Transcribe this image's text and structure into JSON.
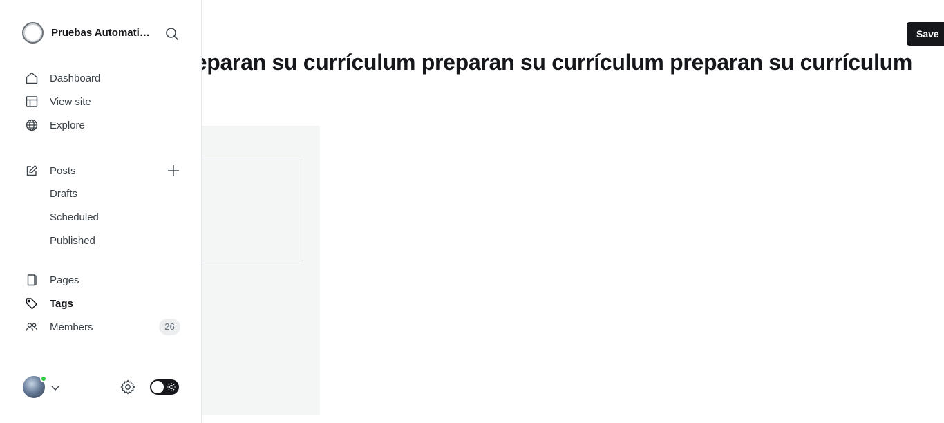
{
  "header": {
    "title": "preparan su currículum preparan su currículum preparan su currículum",
    "save_label": "Save"
  },
  "sidebar": {
    "site_name": "Pruebas Automatizadas",
    "nav_primary": [
      {
        "label": "Dashboard",
        "icon": "home-icon"
      },
      {
        "label": "View site",
        "icon": "layout-icon"
      },
      {
        "label": "Explore",
        "icon": "globe-icon"
      }
    ],
    "posts": {
      "label": "Posts",
      "icon": "edit-icon",
      "sub_items": [
        "Drafts",
        "Scheduled",
        "Published"
      ]
    },
    "nav_secondary": [
      {
        "label": "Pages",
        "icon": "page-icon"
      },
      {
        "label": "Tags",
        "icon": "tag-icon"
      },
      {
        "label": "Members",
        "icon": "members-icon",
        "count": "26"
      }
    ]
  },
  "footer": {
    "online_status_color": "#30cf43",
    "theme_toggle": "dark"
  }
}
